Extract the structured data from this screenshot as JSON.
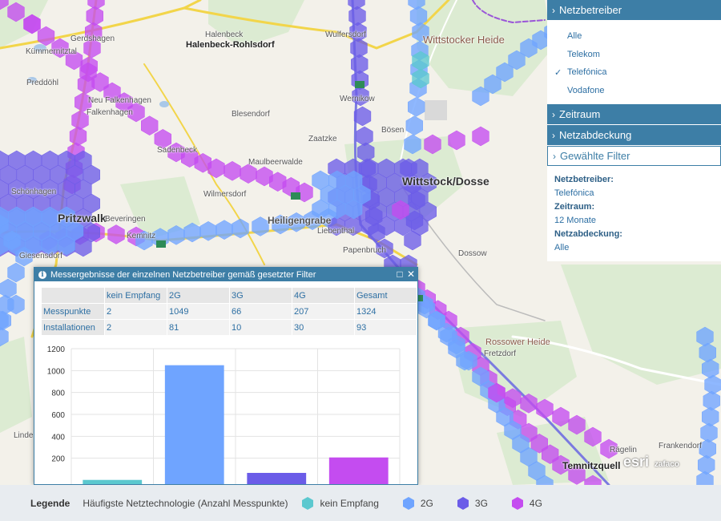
{
  "sidebar": {
    "sections": [
      {
        "title": "Netzbetreiber",
        "expanded": true
      },
      {
        "title": "Zeitraum",
        "expanded": false
      },
      {
        "title": "Netzabdeckung",
        "expanded": false
      },
      {
        "title": "Gewählte Filter",
        "expanded": true
      }
    ],
    "operators": [
      {
        "label": "Alle",
        "checked": false
      },
      {
        "label": "Telekom",
        "checked": false
      },
      {
        "label": "Telefónica",
        "checked": true
      },
      {
        "label": "Vodafone",
        "checked": false
      }
    ],
    "selected_filters": [
      {
        "label": "Netzbetreiber:",
        "value": "Telefónica"
      },
      {
        "label": "Zeitraum:",
        "value": "12 Monate"
      },
      {
        "label": "Netzabdeckung:",
        "value": "Alle"
      }
    ]
  },
  "dialog": {
    "title": "Messergebnisse der einzelnen Netzbetreiber gemäß gesetzter Filter",
    "table": {
      "columns": [
        "kein Empfang",
        "2G",
        "3G",
        "4G",
        "Gesamt"
      ],
      "rows": [
        {
          "label": "Messpunkte",
          "values": [
            "2",
            "1049",
            "66",
            "207",
            "1324"
          ]
        },
        {
          "label": "Installationen",
          "values": [
            "2",
            "81",
            "10",
            "30",
            "93"
          ]
        }
      ]
    }
  },
  "chart_data": {
    "type": "bar",
    "categories": [
      "kein Empfang",
      "2G",
      "3G",
      "4G"
    ],
    "values": [
      2,
      1049,
      66,
      207
    ],
    "colors": [
      "#5bc8cf",
      "#6fa4ff",
      "#6b5ce8",
      "#c44cf0"
    ],
    "ylim": [
      0,
      1200
    ],
    "yticks": [
      200,
      400,
      600,
      800,
      1000,
      1200
    ],
    "grid": true
  },
  "legend": {
    "title": "Legende",
    "subtitle": "Häufigste Netztechnologie (Anzahl Messpunkte)",
    "items": [
      {
        "label": "kein Empfang",
        "color": "#5bc8cf"
      },
      {
        "label": "2G",
        "color": "#6fa4ff"
      },
      {
        "label": "3G",
        "color": "#6b5ce8"
      },
      {
        "label": "4G",
        "color": "#c44cf0"
      }
    ]
  },
  "map": {
    "places": [
      "Gerdshagen",
      "Kümmernitztal",
      "Preddöhl",
      "Halenbeck",
      "Halenbeck-Rohlsdorf",
      "Wulfersdorf",
      "Wittstocker Heide",
      "Neu Falkenhagen",
      "Falkenhagen",
      "Wernikow",
      "Blesendorf",
      "Zaatzke",
      "Sadenbeck",
      "Maulbeerwalde",
      "Wilmersdorf",
      "Pritzwalk",
      "Beveringen",
      "Kemnitz",
      "Heiligengrabe",
      "Liebenthal",
      "Papenbruch",
      "Wittstock/Dosse",
      "Dossow",
      "Giesensdorf",
      "Rossower Heide",
      "Fretzdorf",
      "Rägelin",
      "Temnitzquell",
      "Frankendorf",
      "Linden",
      "Bösen",
      "Schönhagen"
    ],
    "attribution": [
      "esri",
      "zafaco"
    ]
  }
}
